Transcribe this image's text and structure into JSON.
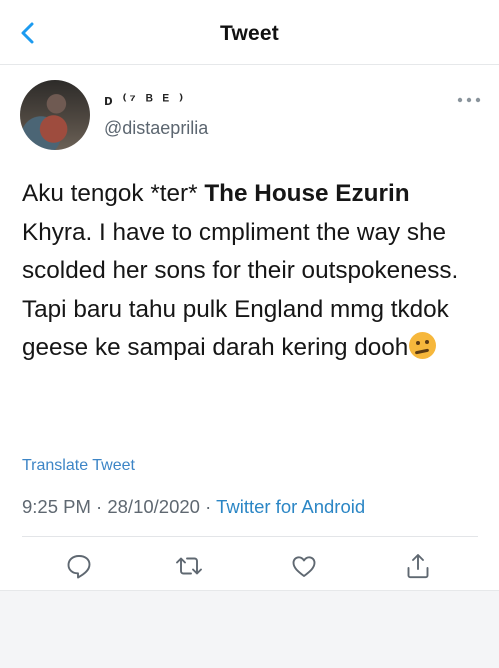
{
  "header": {
    "title": "Tweet",
    "back_icon": "chevron-left-icon",
    "accent_color": "#1d9bf0"
  },
  "tweet": {
    "display_name": "ᴅ ⁽⁷ ᴮ ᴱ ⁾",
    "handle": "@distaeprilia",
    "text": {
      "p1": "Aku tengok *ter* ",
      "bold": "The House Ezurin",
      "p2": " Khyra. I have to cmpliment the way she scolded her sons for their outspokeness. Tapi baru tahu pulk England mmg tkdok geese ke sampai darah kering dooh"
    },
    "translate_label": "Translate Tweet",
    "time": "9:25 PM",
    "separator": " · ",
    "date": "28/10/2020",
    "source": "Twitter for Android"
  },
  "icons": {
    "more": "more-horizontal-icon",
    "reply": "reply-icon",
    "retweet": "retweet-icon",
    "like": "heart-icon",
    "share": "share-icon"
  }
}
